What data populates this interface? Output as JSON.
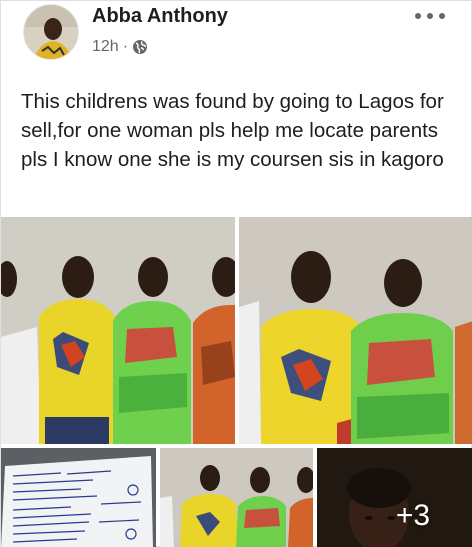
{
  "post": {
    "author": "Abba Anthony",
    "timestamp": "12h",
    "separator": "·",
    "privacy_icon": "globe-icon",
    "more_icon": "ellipsis-icon",
    "text": "This childrens was found by going to Lagos for sell,for one woman pls help me locate parents pls I know one she is my coursen sis in kagoro",
    "photos": {
      "count_shown": 5,
      "more_label": "+3"
    }
  },
  "colors": {
    "text": "#1c1e21",
    "secondary": "#65676b",
    "divider": "#dddfe2"
  }
}
